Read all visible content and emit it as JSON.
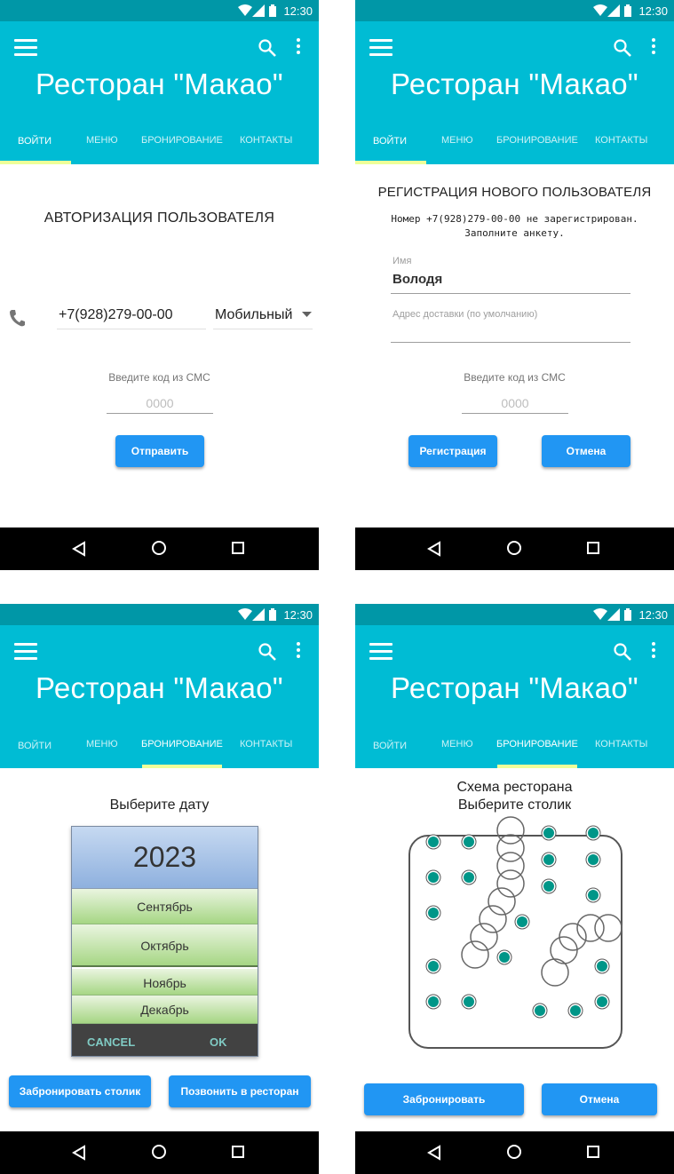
{
  "status_bar": {
    "time": "12:30"
  },
  "app": {
    "title": "Ресторан \"Макао\"",
    "tabs": [
      "ВОЙТИ",
      "МЕНЮ",
      "БРОНИРОВАНИЕ",
      "КОНТАКТЫ"
    ]
  },
  "colors": {
    "primary": "#00bcd4",
    "status_bar": "#0097a7",
    "accent_indicator": "#eeff99",
    "button": "#2196f3",
    "table_dot": "#009688"
  },
  "login": {
    "heading": "АВТОРИЗАЦИЯ ПОЛЬЗОВАТЕЛЯ",
    "phone_value": "+7(928)279-00-00",
    "phone_type": "Мобильный",
    "sms_label": "Введите код из СМС",
    "sms_placeholder": "0000",
    "submit_label": "Отправить"
  },
  "register": {
    "heading": "РЕГИСТРАЦИЯ НОВОГО ПОЛЬЗОВАТЕЛЯ",
    "notice_line1": "Номер +7(928)279-00-00 не зарегистрирован.",
    "notice_line2": "Заполните анкету.",
    "name_label": "Имя",
    "name_value": "Володя",
    "address_placeholder": "Адрес доставки (по умолчанию)",
    "sms_label": "Введите код из СМС",
    "sms_placeholder": "0000",
    "register_label": "Регистрация",
    "cancel_label": "Отмена"
  },
  "date_select": {
    "heading": "Выберите дату",
    "year": "2023",
    "months": [
      "Сентябрь",
      "Октябрь",
      "Ноябрь",
      "Декабрь"
    ],
    "cancel_label": "CANCEL",
    "ok_label": "OK",
    "book_table_label": "Забронировать столик",
    "call_label": "Позвонить в ресторан"
  },
  "table_select": {
    "heading_line1": "Схема ресторана",
    "heading_line2": "Выберите столик",
    "book_label": "Забронировать",
    "cancel_label": "Отмена"
  },
  "icons": [
    "menu-icon",
    "search-icon",
    "more-vert-icon",
    "phone-icon",
    "wifi-icon",
    "signal-icon",
    "battery-icon",
    "back-icon",
    "home-icon",
    "recents-icon",
    "dropdown-arrow-icon"
  ]
}
